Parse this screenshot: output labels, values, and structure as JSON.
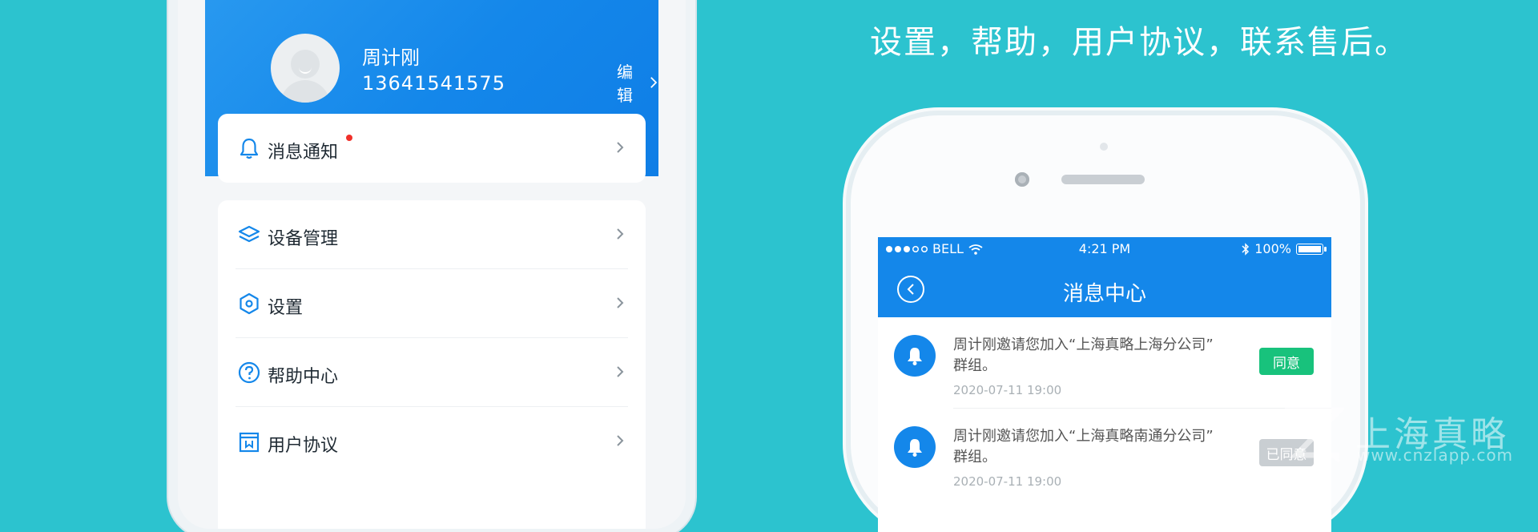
{
  "profile": {
    "name": "周计刚",
    "phone": "13641541575",
    "edit_label": "编辑"
  },
  "menu": {
    "notifications": {
      "label": "消息通知",
      "icon": "bell-icon",
      "has_unread": true
    },
    "items": [
      {
        "label": "设备管理",
        "icon": "layers-icon"
      },
      {
        "label": "设置",
        "icon": "hexagon-settings-icon"
      },
      {
        "label": "帮助中心",
        "icon": "question-circle-icon"
      },
      {
        "label": "用户协议",
        "icon": "agreement-icon"
      }
    ]
  },
  "headline": {
    "partial_line": "设置，帮助，用户协议，联系售后。",
    "line": "设置，帮助，用户协议，联系售后。"
  },
  "device": {
    "status": {
      "carrier": "BELL",
      "time": "4:21 PM",
      "battery": "100%"
    },
    "nav_title": "消息中心",
    "messages": [
      {
        "text_line1": "周计刚邀请您加入“上海真略上海分公司”",
        "text_line2": "群组。",
        "time": "2020-07-11  19:00",
        "action": "同意"
      },
      {
        "text_line1": "周计刚邀请您加入“上海真略南通分公司”",
        "text_line2": "群组。",
        "time": "2020-07-11  19:00",
        "action": "已同意"
      }
    ]
  },
  "watermark": {
    "brand": "上海真略",
    "url": "www.cnzlapp.com"
  },
  "colors": {
    "background": "#2cc3cf",
    "primary_blue": "#1487ea",
    "agree_green": "#18c27c",
    "unread_red": "#f0302a"
  }
}
